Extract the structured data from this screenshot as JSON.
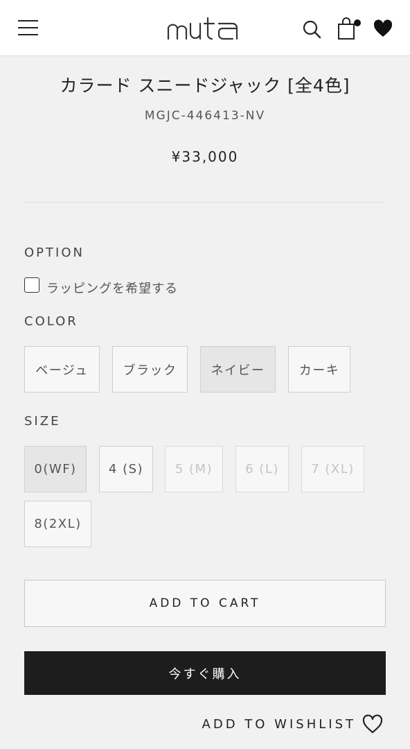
{
  "header": {
    "logo_text": "muta",
    "menu_icon": "hamburger-menu-icon",
    "search_icon": "search-icon",
    "cart_icon": "shopping-bag-icon",
    "wishlist_icon": "heart-icon"
  },
  "product": {
    "title": "カラード スニードジャック [全4色]",
    "sku": "MGJC-446413-NV",
    "price": "¥33,000"
  },
  "option": {
    "label": "OPTION",
    "wrapping_label": "ラッピングを希望する",
    "wrapping_checked": false
  },
  "color": {
    "label": "COLOR",
    "options": [
      {
        "label": "ベージュ",
        "selected": false
      },
      {
        "label": "ブラック",
        "selected": false
      },
      {
        "label": "ネイビー",
        "selected": true
      },
      {
        "label": "カーキ",
        "selected": false
      }
    ]
  },
  "size": {
    "label": "SIZE",
    "options": [
      {
        "label": "0(WF)",
        "selected": true,
        "available": true
      },
      {
        "label": "4 (S)",
        "selected": false,
        "available": true
      },
      {
        "label": "5 (M)",
        "selected": false,
        "available": false
      },
      {
        "label": "6 (L)",
        "selected": false,
        "available": false
      },
      {
        "label": "7 (XL)",
        "selected": false,
        "available": false
      },
      {
        "label": "8(2XL)",
        "selected": false,
        "available": true
      }
    ]
  },
  "actions": {
    "add_to_cart": "ADD TO CART",
    "buy_now": "今すぐ購入",
    "add_to_wishlist": "ADD TO WISHLIST"
  },
  "colors": {
    "background": "#f1f1f1",
    "header_bg": "#ffffff",
    "buy_button_bg": "#1d1d1d",
    "selected_swatch_bg": "#e6e6e6",
    "disabled_text": "#c4c4c4"
  }
}
